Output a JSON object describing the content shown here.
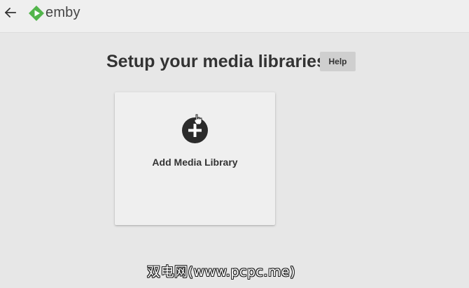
{
  "header": {
    "back_icon": "arrow-left-icon",
    "logo_text": "emby",
    "brand_color": "#52b54b"
  },
  "main": {
    "title": "Setup your media libraries",
    "help_label": "Help",
    "library_card": {
      "icon": "plus-circle-icon",
      "label": "Add Media Library"
    }
  },
  "watermark": {
    "text": "双电网(www.pcpc.me)"
  }
}
